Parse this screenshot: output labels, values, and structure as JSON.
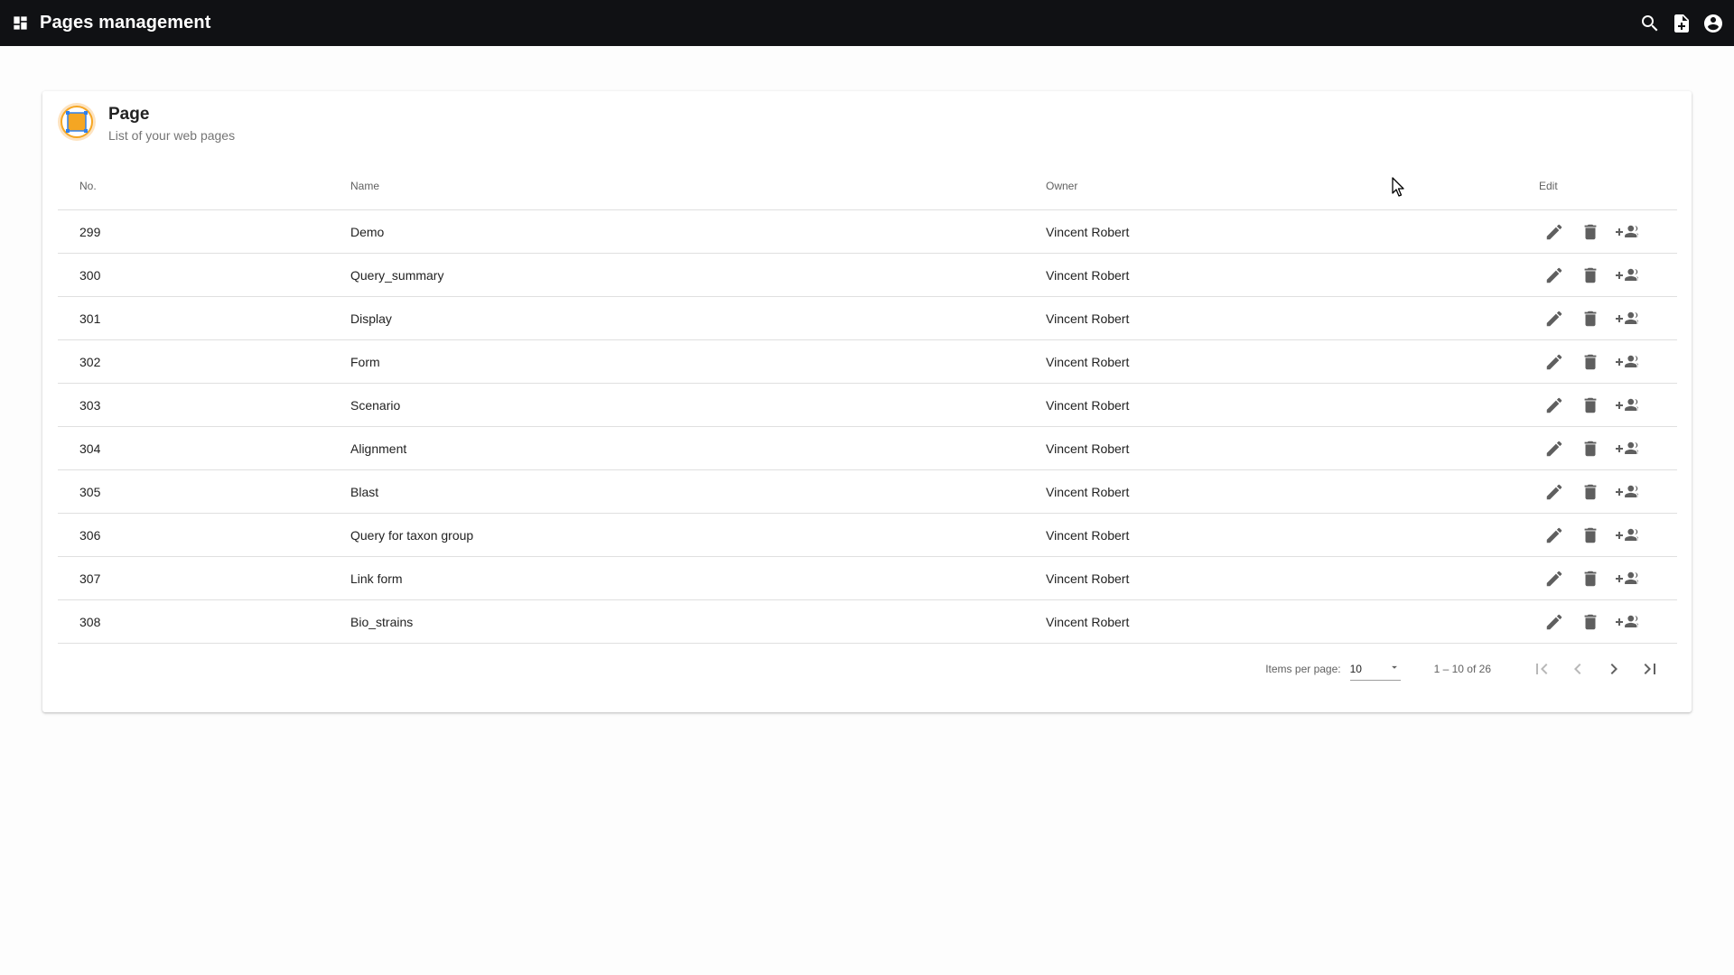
{
  "header": {
    "title": "Pages management",
    "icons": [
      "dashboard-icon",
      "search-icon",
      "add-page-icon",
      "account-circle-icon"
    ]
  },
  "card": {
    "title": "Page",
    "subtitle": "List of your web pages",
    "avatar_icon": "page-layout-icon"
  },
  "table": {
    "columns": [
      "No.",
      "Name",
      "Owner",
      "Edit"
    ],
    "rows": [
      {
        "no": "299",
        "name": "Demo",
        "owner": "Vincent Robert"
      },
      {
        "no": "300",
        "name": "Query_summary",
        "owner": "Vincent Robert"
      },
      {
        "no": "301",
        "name": "Display",
        "owner": "Vincent Robert"
      },
      {
        "no": "302",
        "name": "Form",
        "owner": "Vincent Robert"
      },
      {
        "no": "303",
        "name": "Scenario",
        "owner": "Vincent Robert"
      },
      {
        "no": "304",
        "name": "Alignment",
        "owner": "Vincent Robert"
      },
      {
        "no": "305",
        "name": "Blast",
        "owner": "Vincent Robert"
      },
      {
        "no": "306",
        "name": "Query for taxon group",
        "owner": "Vincent Robert"
      },
      {
        "no": "307",
        "name": "Link form",
        "owner": "Vincent Robert"
      },
      {
        "no": "308",
        "name": "Bio_strains",
        "owner": "Vincent Robert"
      }
    ],
    "row_actions": [
      "edit-icon",
      "delete-icon",
      "add-user-icon"
    ]
  },
  "paginator": {
    "items_per_page_label": "Items per page:",
    "items_per_page_value": "10",
    "range_label": "1 – 10 of 26",
    "buttons": [
      "first-page-icon",
      "previous-page-icon",
      "next-page-icon",
      "last-page-icon"
    ]
  },
  "colors": {
    "topbar": "#101114",
    "accent_orange": "#f5a623",
    "accent_blue": "#2f80ed",
    "icon_gray": "#5f5f5f"
  }
}
